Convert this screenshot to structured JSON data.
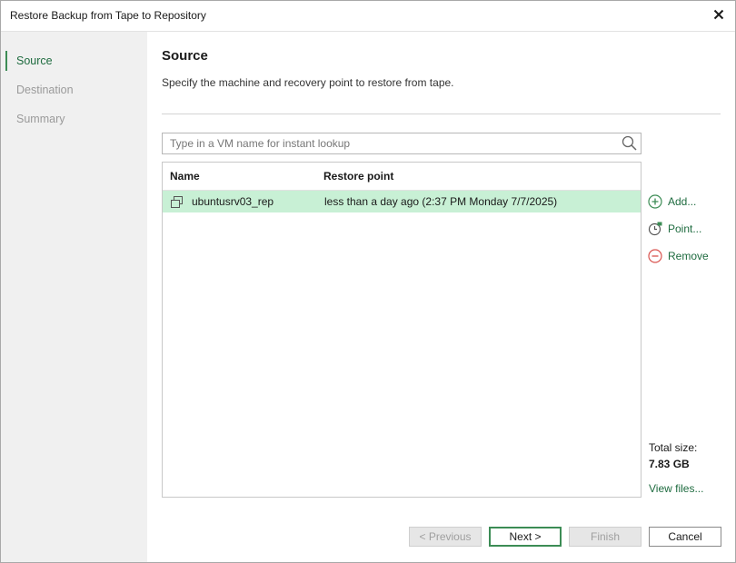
{
  "window": {
    "title": "Restore Backup from Tape to Repository"
  },
  "steps": [
    {
      "label": "Source",
      "active": true
    },
    {
      "label": "Destination",
      "active": false
    },
    {
      "label": "Summary",
      "active": false
    }
  ],
  "page": {
    "heading": "Source",
    "subtitle": "Specify the machine and recovery point to restore from tape."
  },
  "search": {
    "placeholder": "Type in a VM name for instant lookup",
    "value": ""
  },
  "table": {
    "columns": [
      "Name",
      "Restore point"
    ],
    "rows": [
      {
        "name": "ubuntusrv03_rep",
        "restore_point": "less than a day ago (2:37 PM Monday 7/7/2025)",
        "selected": true
      }
    ]
  },
  "actions": {
    "add": "Add...",
    "point": "Point...",
    "remove": "Remove"
  },
  "summary": {
    "total_size_label": "Total size:",
    "total_size_value": "7.83 GB",
    "view_files": "View files..."
  },
  "buttons": {
    "previous": "< Previous",
    "next": "Next >",
    "finish": "Finish",
    "cancel": "Cancel"
  },
  "colors": {
    "accent": "#3c8c55",
    "selected_row": "#c8f0d5",
    "remove": "#d9534f",
    "sidebar": "#f0f0f0"
  },
  "icons": {
    "close": "close-icon",
    "search": "search-icon",
    "vm": "vm-icon",
    "add": "plus-circle-icon",
    "point": "clock-icon",
    "remove": "minus-circle-icon"
  }
}
